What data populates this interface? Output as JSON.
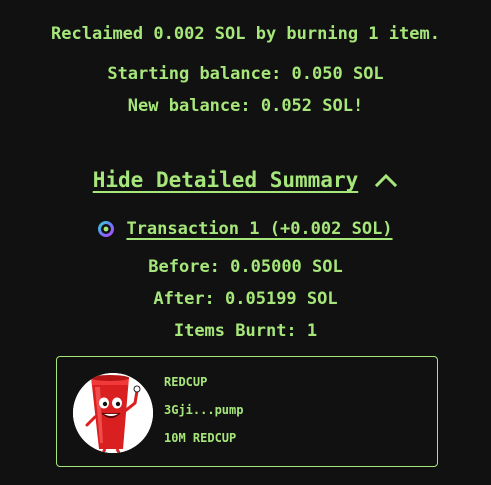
{
  "summary": {
    "reclaimed_text": "Reclaimed 0.002 SOL by burning 1 item.",
    "starting_balance": "Starting balance: 0.050 SOL",
    "new_balance": "New balance: 0.052 SOL!"
  },
  "details": {
    "toggle_label": "Hide Detailed Summary",
    "toggle_icon": "chevron-up-icon",
    "transaction": {
      "icon": "solana-explorer-icon",
      "label": "Transaction 1 (+0.002 SOL)",
      "before": "Before: 0.05000 SOL",
      "after": "After: 0.05199 SOL",
      "items_burnt": "Items Burnt: 1"
    }
  },
  "token_card": {
    "name": "REDCUP",
    "address": "3Gji...pump",
    "amount": "10M REDCUP"
  },
  "colors": {
    "background": "#111111",
    "accent": "#a6e67a"
  }
}
